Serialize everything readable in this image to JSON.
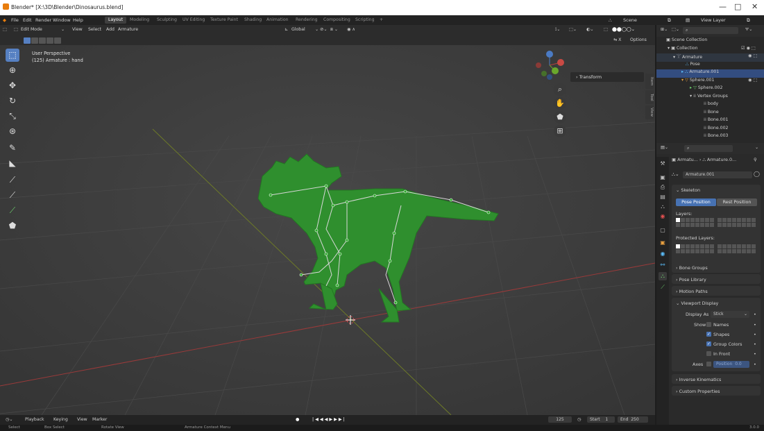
{
  "titlebar": {
    "title": "Blender* [X:\\3D\\Blender\\Dinosaurus.blend]",
    "min": "—",
    "max": "□",
    "close": "✕"
  },
  "menu": {
    "items": [
      "File",
      "Edit",
      "Render",
      "Window",
      "Help"
    ],
    "workspaces": [
      "Layout",
      "Modeling",
      "Sculpting",
      "UV Editing",
      "Texture Paint",
      "Shading",
      "Animation",
      "Rendering",
      "Compositing",
      "Scripting"
    ],
    "add_tab": "+",
    "scene": "Scene",
    "view_layer": "View Layer"
  },
  "viewport": {
    "mode": "Edit Mode",
    "header_menus": [
      "View",
      "Select",
      "Add",
      "Armature"
    ],
    "orientation": "Global",
    "options": "Options",
    "overlay_title": "User Perspective",
    "overlay_sub": "(125) Armature : hand",
    "transform_label": "Transform",
    "side_tabs": [
      "Item",
      "Tool",
      "View"
    ],
    "gizmo": {
      "x": "X",
      "y": "Y",
      "z": "Z"
    },
    "bone_color": "#d8d8d8",
    "model_color": "#2f8f2e"
  },
  "timeline": {
    "menus": [
      "Playback",
      "Keying",
      "View",
      "Marker"
    ],
    "current_frame": "125",
    "start_label": "Start",
    "start": "1",
    "end_label": "End",
    "end": "250"
  },
  "status": {
    "select": "Select",
    "box_select": "Box Select",
    "rotate": "Rotate View",
    "context": "Armature Context Menu",
    "version": "3.0.0"
  },
  "outliner": {
    "search_placeholder": "",
    "rows": [
      {
        "label": "Scene Collection"
      },
      {
        "label": "Collection"
      },
      {
        "label": "Armature"
      },
      {
        "label": "Pose"
      },
      {
        "label": "Armature.001"
      },
      {
        "label": "Sphere.001"
      },
      {
        "label": "Sphere.002"
      },
      {
        "label": "Vertex Groups"
      },
      {
        "label": "body"
      },
      {
        "label": "Bone"
      },
      {
        "label": "Bone.001"
      },
      {
        "label": "Bone.002"
      },
      {
        "label": "Bone.003"
      }
    ]
  },
  "properties": {
    "breadcrumb_a": "Armatu...",
    "breadcrumb_b": "Armature.0...",
    "datablock": "Armature.001",
    "skeleton": "Skeleton",
    "pose_position": "Pose Position",
    "rest_position": "Rest Position",
    "layers": "Layers:",
    "protected_layers": "Protected Layers:",
    "bone_groups": "Bone Groups",
    "pose_library": "Pose Library",
    "motion_paths": "Motion Paths",
    "viewport_display": "Viewport Display",
    "display_as_label": "Display As",
    "display_as": "Stick",
    "show_label": "Show",
    "names": "Names",
    "shapes": "Shapes",
    "group_colors": "Group Colors",
    "in_front": "In Front",
    "axes_label": "Axes",
    "axes_position": "Position",
    "axes_value": "0.0",
    "inverse_kinematics": "Inverse Kinematics",
    "custom_properties": "Custom Properties"
  }
}
